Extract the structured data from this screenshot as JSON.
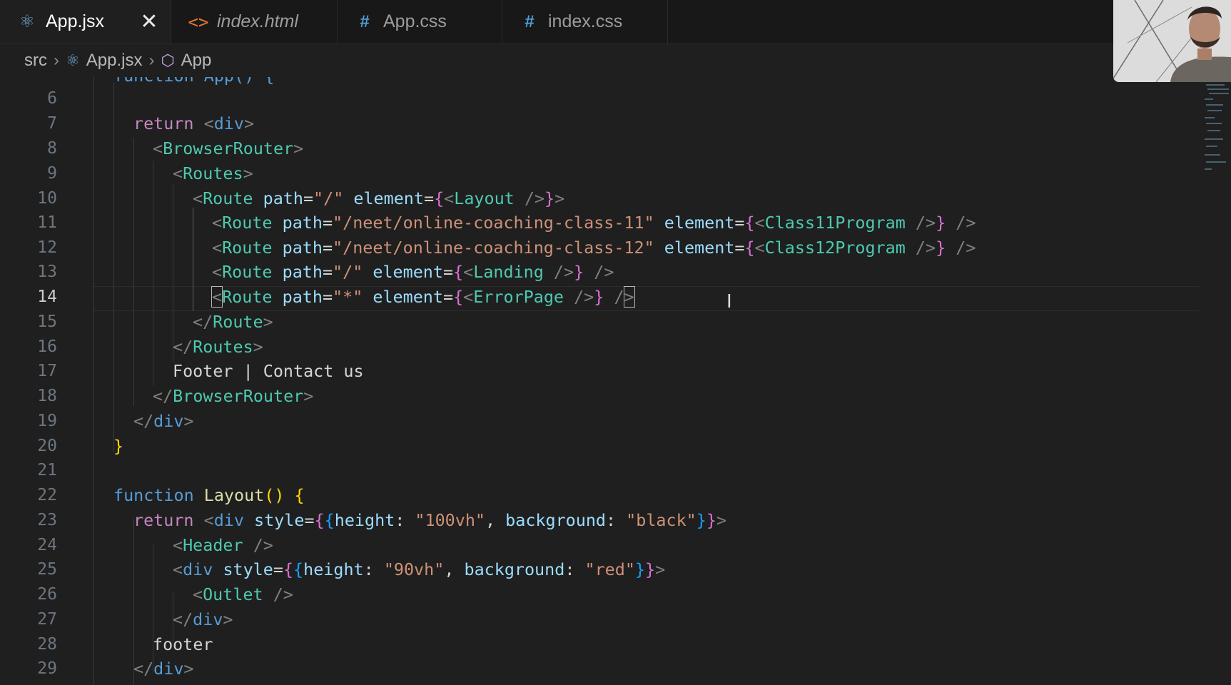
{
  "tabs": [
    {
      "label": "App.jsx",
      "icon": "react-icon",
      "active": true,
      "closable": true
    },
    {
      "label": "index.html",
      "icon": "html-icon",
      "active": false,
      "italic": true
    },
    {
      "label": "App.css",
      "icon": "css-hash-icon",
      "active": false
    },
    {
      "label": "index.css",
      "icon": "css-hash-icon",
      "active": false
    }
  ],
  "breadcrumb": {
    "folder": "src",
    "file": "App.jsx",
    "symbol": "App"
  },
  "partial_line_5": "function App() {",
  "line_numbers": [
    "6",
    "7",
    "8",
    "9",
    "10",
    "11",
    "12",
    "13",
    "14",
    "15",
    "16",
    "17",
    "18",
    "19",
    "20",
    "21",
    "22",
    "23",
    "24",
    "25",
    "26",
    "27",
    "28",
    "29"
  ],
  "current_line": "14",
  "code": {
    "kw_return": "return",
    "kw_function": "function",
    "div": "div",
    "browser_router": "BrowserRouter",
    "routes": "Routes",
    "route": "Route",
    "path_attr": "path",
    "element_attr": "element",
    "style_attr": "style",
    "root_path": "\"/\"",
    "class11_path": "\"/neet/online-coaching-class-11\"",
    "class12_path": "\"/neet/online-coaching-class-12\"",
    "star_path": "\"*\"",
    "layout": "Layout",
    "class11": "Class11Program",
    "class12": "Class12Program",
    "landing": "Landing",
    "error_page": "ErrorPage",
    "footer_text": "Footer | Contact us",
    "layout_fn": "Layout",
    "height_key": "height",
    "background_key": "background",
    "h100": "\"100vh\"",
    "black": "\"black\"",
    "h90": "\"90vh\"",
    "red": "\"red\"",
    "header": "Header",
    "outlet": "Outlet",
    "footer_lower": "footer"
  },
  "colors": {
    "background": "#1f1f1f",
    "keyword": "#c586c0",
    "tag": "#4ec9b0",
    "string": "#ce9178",
    "attribute": "#9cdcfe"
  }
}
